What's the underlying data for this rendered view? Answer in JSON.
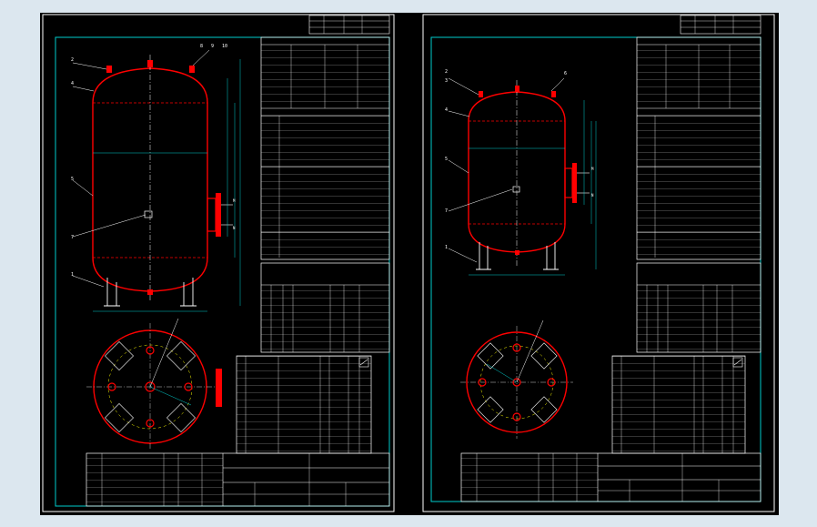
{
  "colors": {
    "workspace": "#000000",
    "frame": "#00cccc",
    "vessel": "#ff0000",
    "table_line": "#ffffff",
    "dimension": "#00cccc",
    "leader": "#ffffff",
    "nozzle_accent": "#ffff00",
    "page_bg": "#dce7ef"
  },
  "drawings": [
    {
      "id": "left",
      "balloons": [
        "1",
        "2",
        "3",
        "4",
        "5",
        "6",
        "7",
        "8",
        "9",
        "10"
      ],
      "side_marks": [
        "M",
        "N"
      ]
    },
    {
      "id": "right",
      "balloons": [
        "1",
        "2",
        "3",
        "4",
        "5",
        "6",
        "7"
      ],
      "side_marks": [
        "M",
        "N"
      ]
    }
  ]
}
